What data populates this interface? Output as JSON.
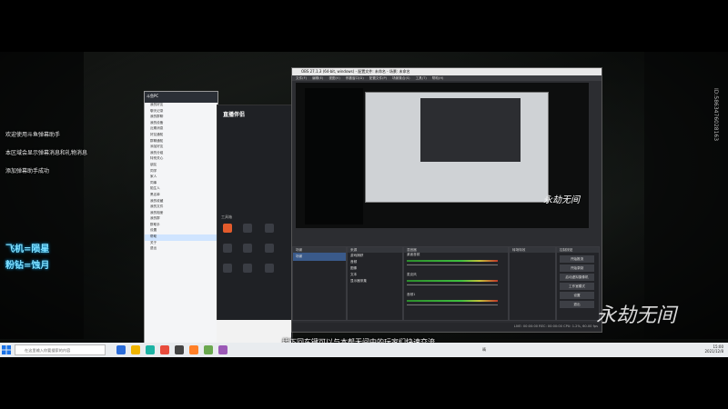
{
  "chat_messages": [
    "欢迎使用斗鱼弹幕助手",
    "本区域会显示弹幕消息和礼物消息",
    "添加弹幕助手成功"
  ],
  "side_info": [
    "飞机=陨星",
    "粉钻=蚀月"
  ],
  "vertical_id": "ID:5863476028163",
  "watermark_text": "永劫无间",
  "subtitle": "找下回车键可以与本帮无间中的玩家们快速交流",
  "qq_window": {
    "title": "斗鱼PC",
    "items": [
      "我的好友",
      "聊天记录",
      "我的群聊",
      "我的设备",
      "近期消息",
      "好友通知",
      "群聊通知",
      "添加好友",
      "我的分组",
      "特别关心",
      "朋友",
      "同学",
      "家人",
      "同事",
      "陌生人",
      "黑名单",
      "我的收藏",
      "我的文件",
      "我的相册",
      "我的群",
      "群助手",
      "设置",
      "帮助",
      "关于",
      "退出"
    ]
  },
  "app_panel": {
    "logo": "直播伴侣",
    "tool_label": "工具箱"
  },
  "obs": {
    "title": "OBS 27.1.3 (64-bit, windows) - 配置文件: 未命名 - 场景: 未命名",
    "menu": [
      "文件(F)",
      "编辑(E)",
      "视图(V)",
      "停靠窗口(D)",
      "配置文件(P)",
      "场景集合(S)",
      "工具(T)",
      "帮助(H)"
    ],
    "docks": [
      "场景",
      "来源",
      "混音器",
      "转场特效",
      "控制按钮"
    ],
    "scenes": [
      "场景"
    ],
    "sources": [
      "游戏捕获",
      "音频",
      "图像",
      "文本",
      "显示器采集"
    ],
    "mixer_tracks": [
      "桌面音频",
      "麦克风",
      "音频1"
    ],
    "controls": [
      "开始推流",
      "开始录制",
      "启动虚拟摄像机",
      "工作室模式",
      "设置",
      "退出"
    ],
    "statusbar": "LIVE: 00:00:00  REC: 00:00:00  CPU: 1.2%, 60.00 fps"
  },
  "taskbar": {
    "search_placeholder": "在这里输入你要搜索的内容",
    "weather": "晴",
    "time": "15:00",
    "date": "2021/12/8"
  }
}
